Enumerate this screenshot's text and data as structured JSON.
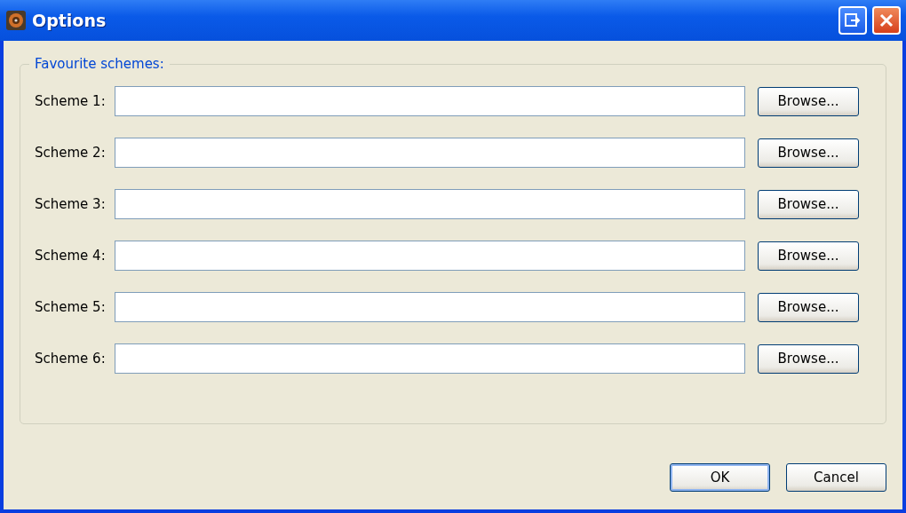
{
  "window": {
    "title": "Options"
  },
  "group": {
    "legend": "Favourite schemes:",
    "rows": [
      {
        "label": "Scheme 1:",
        "button": "Browse..."
      },
      {
        "label": "Scheme 2:",
        "button": "Browse..."
      },
      {
        "label": "Scheme 3:",
        "button": "Browse..."
      },
      {
        "label": "Scheme 4:",
        "button": "Browse..."
      },
      {
        "label": "Scheme 5:",
        "button": "Browse..."
      },
      {
        "label": "Scheme 6:",
        "button": "Browse..."
      }
    ]
  },
  "buttons": [
    {
      "label": "OK",
      "default": true
    },
    {
      "label": "Cancel",
      "default": false
    }
  ]
}
